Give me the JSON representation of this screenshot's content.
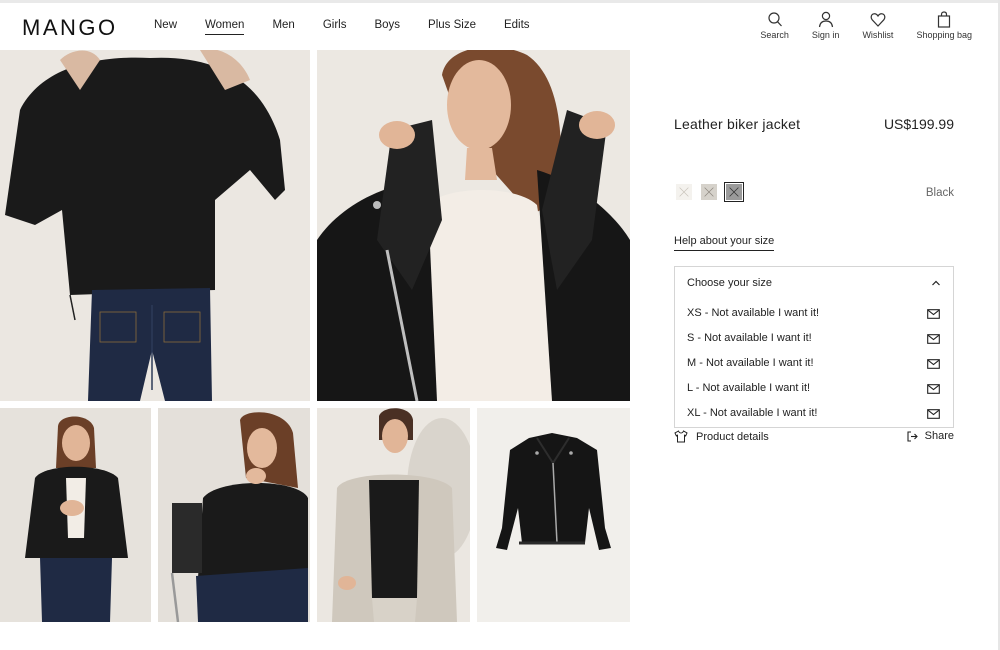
{
  "header": {
    "logo": "MANGO",
    "nav": [
      "New",
      "Women",
      "Men",
      "Girls",
      "Boys",
      "Plus Size",
      "Edits"
    ],
    "active_nav": "Women",
    "actions": {
      "search": "Search",
      "signin": "Sign in",
      "wishlist": "Wishlist",
      "bag": "Shopping bag"
    }
  },
  "product": {
    "title": "Leather biker jacket",
    "price": "US$199.99",
    "color_name": "Black",
    "swatch_colors": [
      "#f4f2ee",
      "#d6d2cb",
      "#9a9a9a"
    ],
    "help_size": "Help about your size",
    "size_header": "Choose your size",
    "sizes": [
      "XS - Not available I want it!",
      "S - Not available I want it!",
      "M - Not available I want it!",
      "L - Not available I want it!",
      "XL - Not available I want it!"
    ],
    "details": "Product details",
    "share": "Share"
  },
  "gallery": {
    "images": [
      "back-view-photo",
      "close-up-collar-photo",
      "front-view-photo",
      "seated-photo",
      "layered-look-photo",
      "flat-lay-photo"
    ]
  }
}
